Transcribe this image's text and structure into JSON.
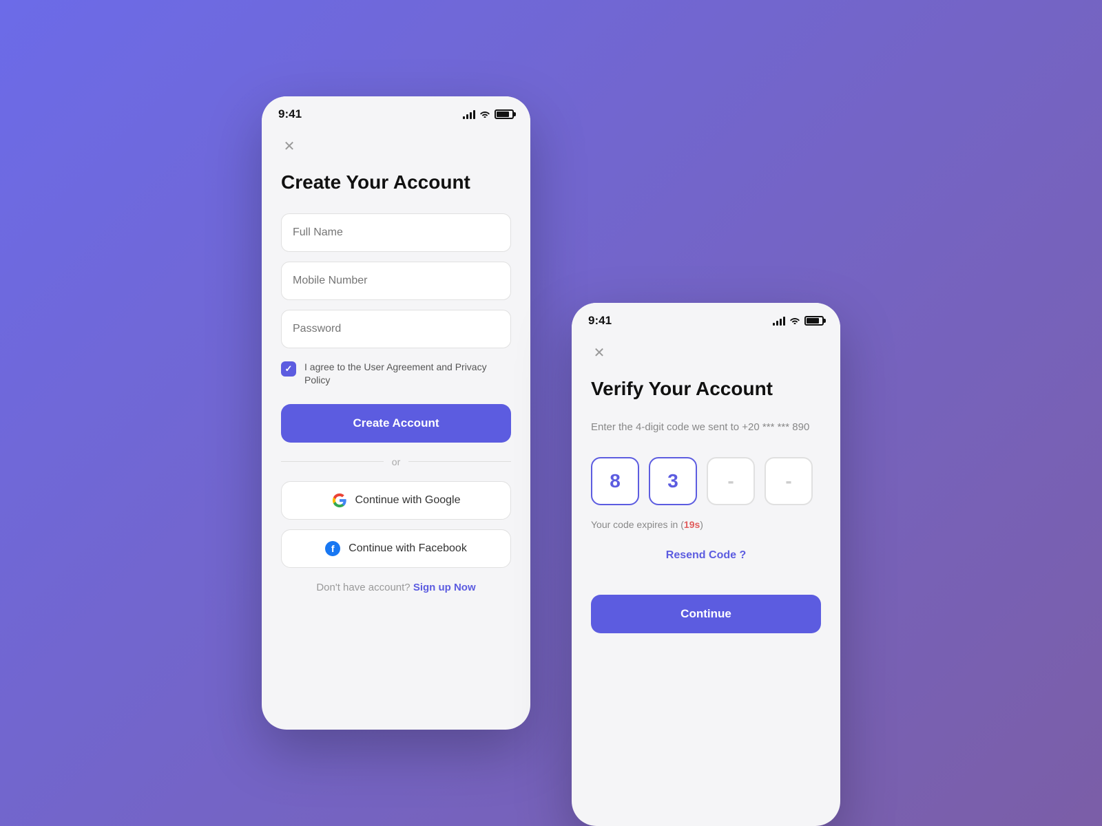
{
  "background": "#6c6be8",
  "accent": "#5c5ce0",
  "card1": {
    "statusTime": "9:41",
    "closeIcon": "✕",
    "title": "Create Your Account",
    "fields": [
      {
        "placeholder": "Full Name"
      },
      {
        "placeholder": "Mobile Number"
      },
      {
        "placeholder": "Password"
      }
    ],
    "checkboxLabel": "I agree to the User Agreement and Privacy Policy",
    "createAccountBtn": "Create Account",
    "dividerText": "or",
    "googleBtn": "Continue with Google",
    "facebookBtn": "Continue with Facebook",
    "signupText": "Don't have account?",
    "signupLink": "Sign up Now"
  },
  "card2": {
    "statusTime": "9:41",
    "closeIcon": "✕",
    "title": "Verify Your Account",
    "description": "Enter the 4-digit code we sent to +20 *** *** 890",
    "otpDigits": [
      "8",
      "3",
      "-",
      "-"
    ],
    "expireText": "Your code expires in (",
    "expireTime": "19s",
    "expireClose": ")",
    "resendLink": "Resend Code ?",
    "continueBtn": "Continue"
  }
}
